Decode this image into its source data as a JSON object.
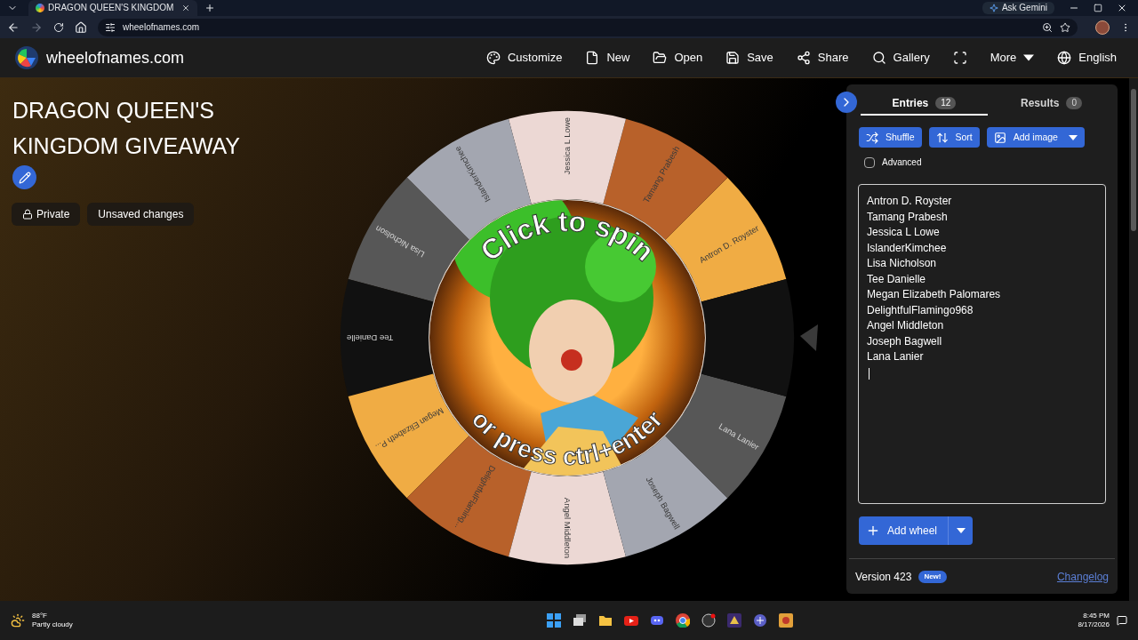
{
  "browser": {
    "tab_title": "DRAGON QUEEN'S KINGDOM",
    "assistant_button": "Ask Gemini",
    "url": "wheelofnames.com"
  },
  "header": {
    "brand": "wheelofnames.com",
    "menu": [
      {
        "kind": "link",
        "label": "Customize"
      },
      {
        "kind": "link",
        "label": "New"
      },
      {
        "kind": "link",
        "label": "Open"
      },
      {
        "kind": "link",
        "label": "Save"
      },
      {
        "kind": "link",
        "label": "Share"
      },
      {
        "kind": "link",
        "label": "Gallery"
      },
      {
        "kind": "icon"
      },
      {
        "kind": "dropdown",
        "label": "More"
      },
      {
        "kind": "link",
        "label": "English"
      }
    ]
  },
  "title": "DRAGON QUEEN'S KINGDOM GIVEAWAY",
  "chips": [
    {
      "kind": "lock",
      "label": "Private"
    },
    {
      "kind": "plain",
      "label": "Unsaved changes"
    }
  ],
  "wheel": {
    "slices": [
      {
        "label": "Antron D. Royster",
        "color": "#f0ac44"
      },
      {
        "label": "Tamang Prabesh",
        "color": "#b8612a"
      },
      {
        "label": "Jessica L Lowe",
        "color": "#ecd8d4"
      },
      {
        "label": "IslanderKimchee",
        "color": "#a3a6b0"
      },
      {
        "label": "Lisa Nicholson",
        "color": "#575757"
      },
      {
        "label": "Tee Danielle",
        "color": "#111111"
      },
      {
        "label": "Megan Elizabeth P...",
        "color": "#f0ac44"
      },
      {
        "label": "DelightfulFlaming...",
        "color": "#b8612a"
      },
      {
        "label": "Angel Middleton",
        "color": "#ecd8d4"
      },
      {
        "label": "Joseph Bagwell",
        "color": "#a3a6b0"
      },
      {
        "label": "Lana Lanier",
        "color": "#575757"
      },
      {
        "color": "#111111"
      }
    ],
    "hint_top": "Click to spin",
    "hint_bottom": "or press ctrl+enter"
  },
  "panel": {
    "tabs": [
      {
        "label": "Entries",
        "count": "12",
        "selected": true
      },
      {
        "label": "Results",
        "count": "0",
        "selected": false
      }
    ],
    "actions": [
      {
        "kind": "button",
        "label": "Shuffle"
      },
      {
        "kind": "button",
        "label": "Sort"
      },
      {
        "kind": "dropdown",
        "label": "Add image"
      }
    ],
    "advanced": {
      "label": "Advanced",
      "checked": false
    },
    "entries": [
      "Antron D. Royster",
      "Tamang Prabesh",
      "Jessica L Lowe",
      "IslanderKimchee",
      "Lisa Nicholson",
      "Tee Danielle",
      "Megan Elizabeth Palomares",
      "DelightfulFlamingo968",
      "Angel Middleton",
      "Joseph Bagwell",
      "Lana Lanier"
    ],
    "add_wheel": "Add wheel",
    "version": "Version 423",
    "version_badge": "New!",
    "changelog": "Changelog"
  },
  "taskbar": {
    "temperature": "88°F",
    "weather": "Partly cloudy",
    "time": "8:45 PM",
    "date": "8/17/2026"
  }
}
